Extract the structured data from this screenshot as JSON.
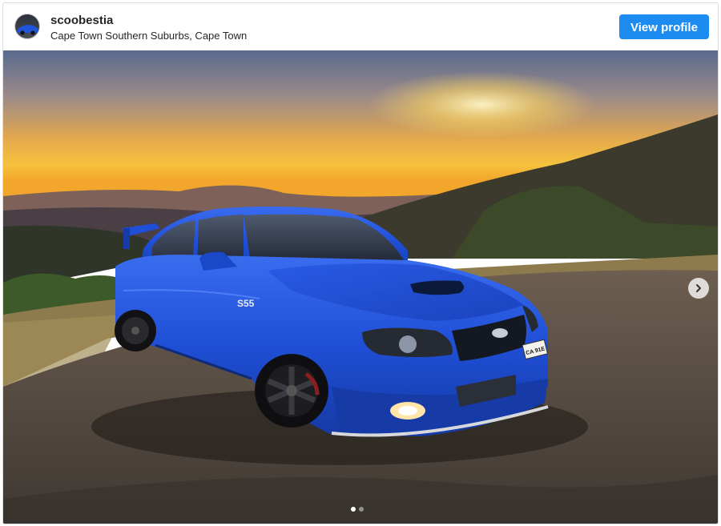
{
  "post": {
    "username": "scoobestia",
    "location": "Cape Town Southern Suburbs, Cape Town",
    "view_profile_label": "View profile"
  },
  "carousel": {
    "current_slide": 1,
    "total_slides": 2,
    "next_icon": "chevron-right-icon"
  },
  "photo": {
    "badge_text": "S55",
    "plate_text": "CA 91E",
    "colors": {
      "sky_top": "#5b6a8c",
      "sky_horizon": "#f2b43a",
      "car_blue": "#1f4fd6",
      "button_blue": "#1c8cf0"
    }
  }
}
